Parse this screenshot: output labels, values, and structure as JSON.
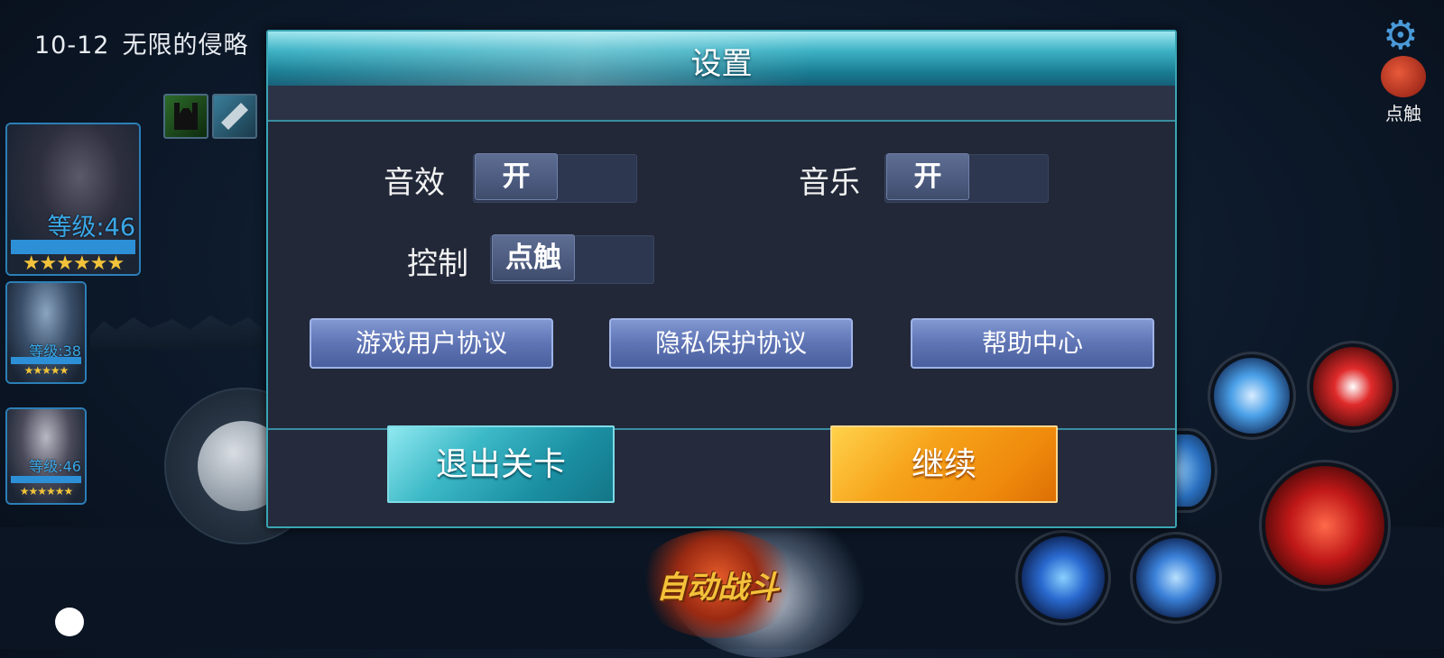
{
  "hud": {
    "stage_number": "10-12",
    "stage_name": "无限的侵略",
    "settings_icon": "gear-icon",
    "touch_mode_label": "点触",
    "auto_battle_label": "自动战斗"
  },
  "team": [
    {
      "level_text": "等级:46",
      "stars": "★★★★★★"
    },
    {
      "level_text": "等级:38",
      "stars": "★★★★★"
    },
    {
      "level_text": "等级:46",
      "stars": "★★★★★★"
    }
  ],
  "dialog": {
    "title": "设置",
    "sound_effects": {
      "label": "音效",
      "state": "开"
    },
    "music": {
      "label": "音乐",
      "state": "开"
    },
    "control": {
      "label": "控制",
      "state": "点触"
    },
    "links": {
      "user_agreement": "游戏用户协议",
      "privacy_agreement": "隐私保护协议",
      "help_center": "帮助中心"
    },
    "exit_button": "退出关卡",
    "continue_button": "继续"
  },
  "colors": {
    "dialog_border": "#3aa6b4",
    "exit_button": "#3bb8c6",
    "continue_button": "#f6a21a",
    "link_button": "#5f74b4"
  }
}
